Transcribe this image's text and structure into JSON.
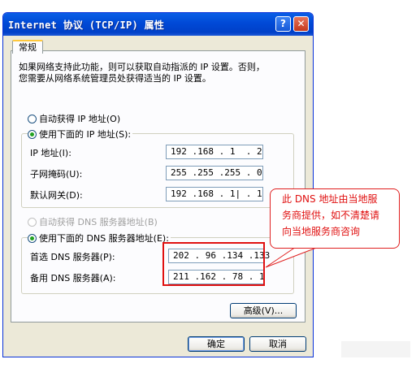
{
  "window": {
    "title": "Internet 协议 (TCP/IP) 属性",
    "help_glyph": "?",
    "close_glyph": "✕"
  },
  "tabs": [
    {
      "label": "常规"
    }
  ],
  "description": [
    "如果网络支持此功能，则可以获取自动指派的 IP 设置。否则，",
    "您需要从网络系统管理员处获得适当的 IP 设置。"
  ],
  "ip_section": {
    "auto_label": "自动获得 IP 地址(O)",
    "manual_label": "使用下面的 IP 地址(S):",
    "selected": "manual",
    "fields": [
      {
        "label": "IP 地址(I):",
        "value": "192 .168 . 1  . 2"
      },
      {
        "label": "子网掩码(U):",
        "value": "255 .255 .255 . 0"
      },
      {
        "label": "默认网关(D):",
        "value": "192 .168 . 1| . 1"
      }
    ]
  },
  "dns_section": {
    "auto_label": "自动获得 DNS 服务器地址(B)",
    "manual_label": "使用下面的 DNS 服务器地址(E):",
    "selected": "manual",
    "fields": [
      {
        "label": "首选 DNS 服务器(P):",
        "value": "202 . 96 .134 .133"
      },
      {
        "label": "备用 DNS 服务器(A):",
        "value": "211 .162 . 78 . 1"
      }
    ]
  },
  "annotation": {
    "lines": [
      "此 DNS 地址由当地服",
      "务商提供，如不清楚请",
      "向当地服务商咨询"
    ],
    "color": "#e01010"
  },
  "buttons": {
    "advanced": "高级(V)...",
    "ok": "确定",
    "cancel": "取消"
  },
  "colors": {
    "titlebar": "#0049d6",
    "dialog_bg": "#ece9d8",
    "radio_dot": "#21a121"
  }
}
